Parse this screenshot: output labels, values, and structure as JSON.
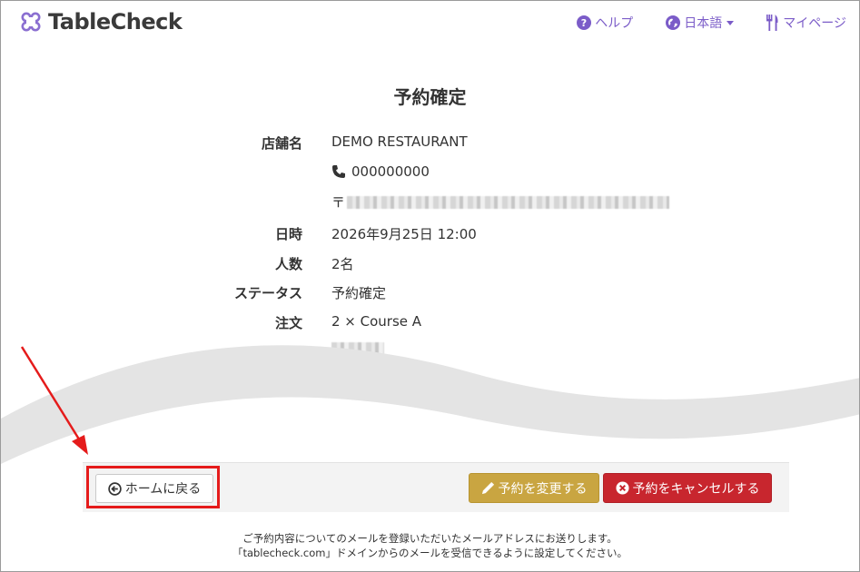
{
  "header": {
    "logo_text": "TableCheck",
    "help_label": "ヘルプ",
    "language_label": "日本語",
    "mypage_label": "マイページ",
    "accent_color": "#7b5cc8"
  },
  "page": {
    "title": "予約確定"
  },
  "details": {
    "store_label": "店舗名",
    "store_name": "DEMO RESTAURANT",
    "phone": "000000000",
    "postal_mark": "〒",
    "datetime_label": "日時",
    "datetime": "2026年9月25日 12:00",
    "people_label": "人数",
    "people": "2名",
    "status_label": "ステータス",
    "status": "予約確定",
    "order_label": "注文",
    "order": "2 × Course A"
  },
  "actions": {
    "home_label": "ホームに戻る",
    "change_label": "予約を変更する",
    "cancel_label": "予約をキャンセルする",
    "change_color": "#c9a541",
    "cancel_color": "#c8262e"
  },
  "notice": {
    "line1": "ご予約内容についてのメールを登録いただいたメールアドレスにお送りします。",
    "line2": "「tablecheck.com」ドメインからのメールを受信できるように設定してください。"
  },
  "annotation": {
    "color": "#e51b1b"
  }
}
